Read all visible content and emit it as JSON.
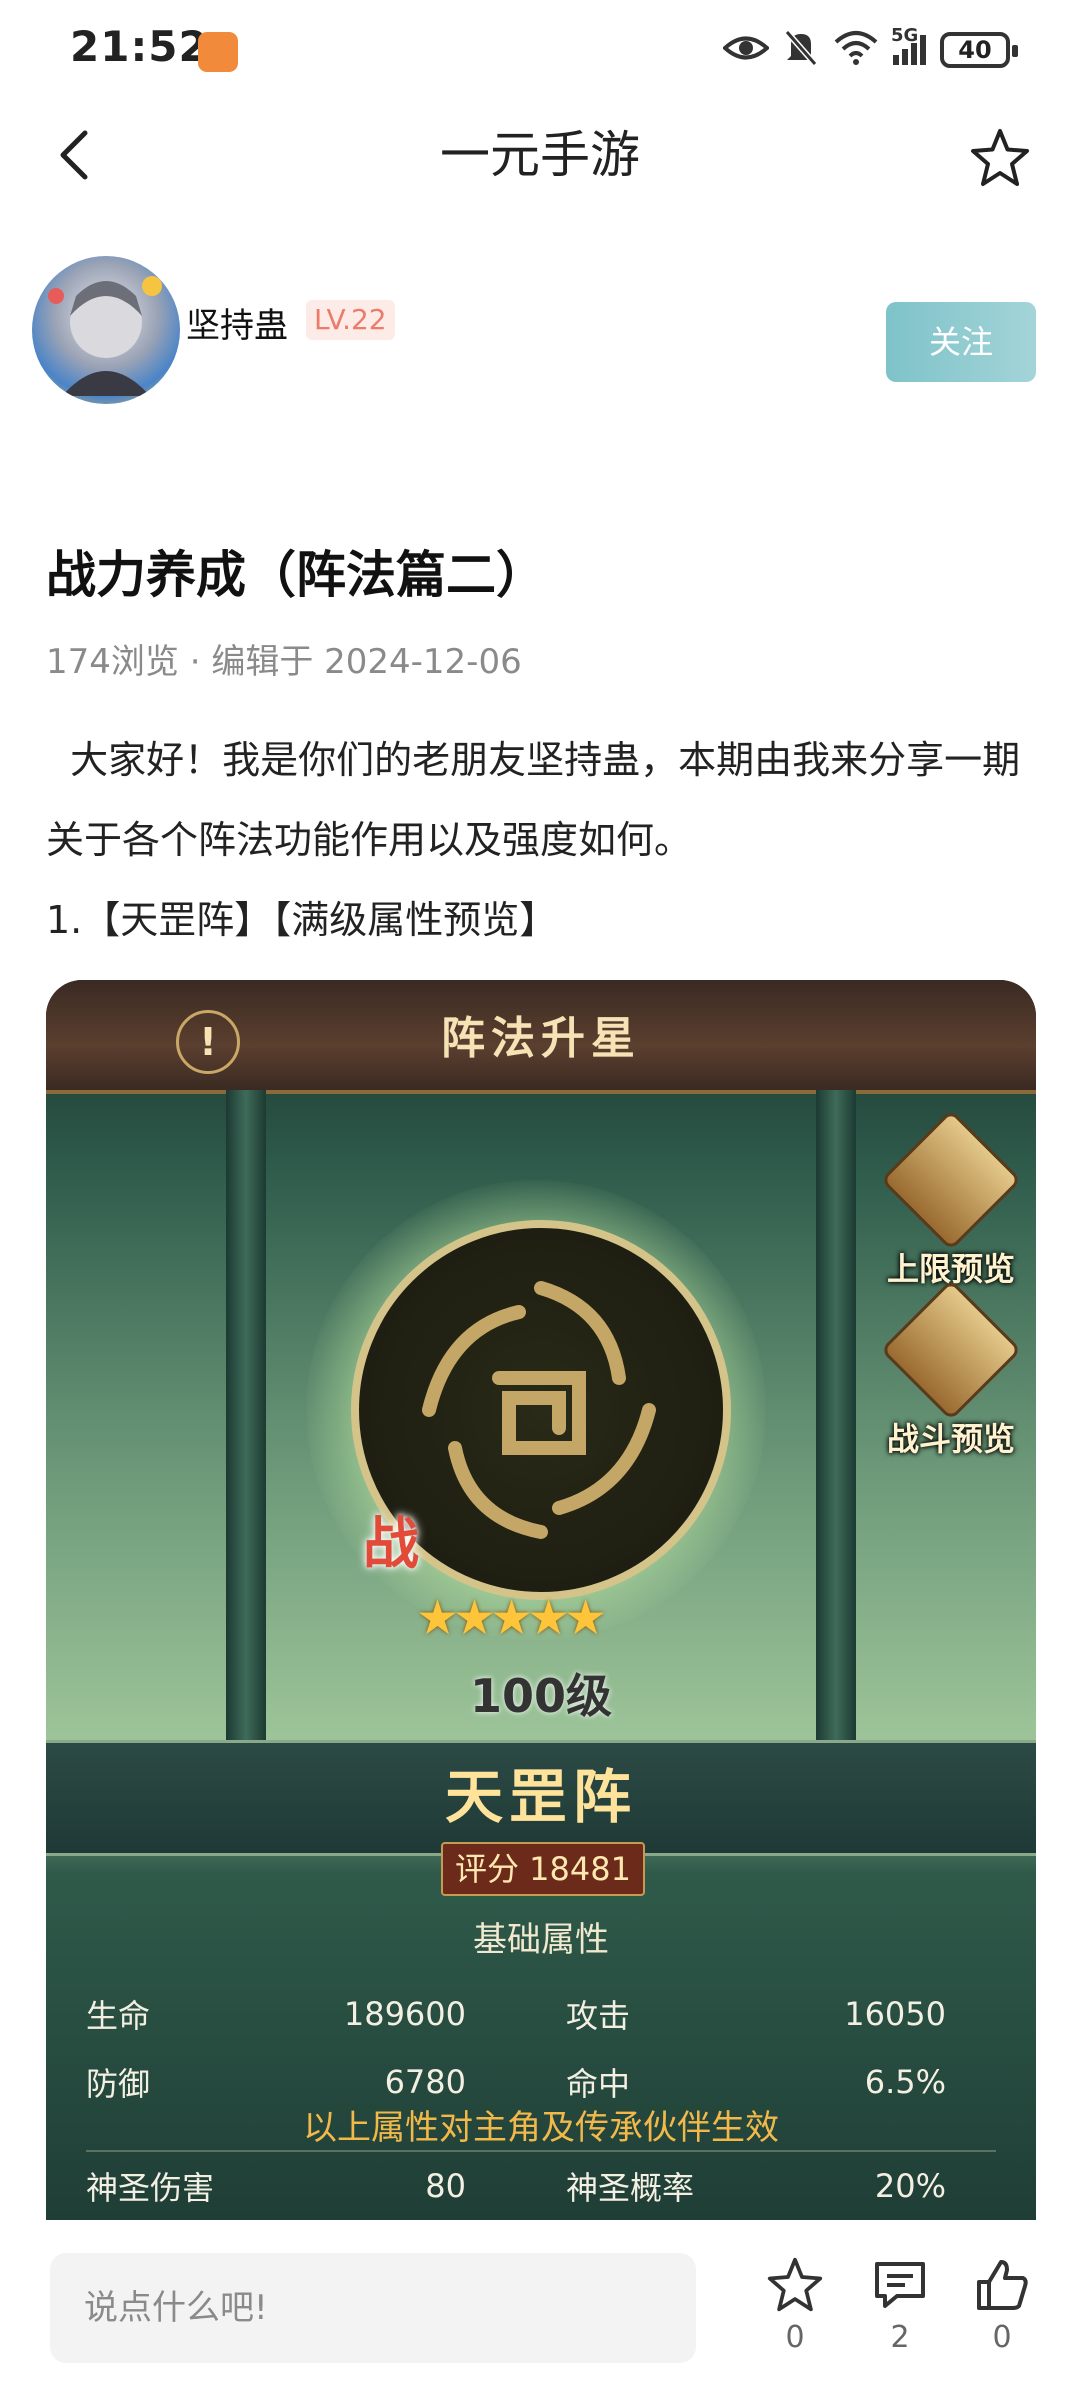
{
  "status_bar": {
    "time": "21:52",
    "battery": "40",
    "network": "5G"
  },
  "nav": {
    "title": "一元手游"
  },
  "author": {
    "name": "坚持蛊",
    "level": "LV.22",
    "follow_label": "关注"
  },
  "post": {
    "title": "战力养成（阵法篇二）",
    "meta": "174浏览 · 编辑于 2024-12-06",
    "paragraphs": [
      "  大家好！我是你们的老朋友坚持蛊，本期由我来分享一期关于各个阵法功能作用以及强度如何。",
      "1.【天罡阵】【满级属性预览】"
    ]
  },
  "game_screenshot": {
    "header_title": "阵法升星",
    "info_icon": "!",
    "side_buttons": [
      {
        "label": "上限预览"
      },
      {
        "label": "战斗预览"
      }
    ],
    "battle_badge": "战",
    "stars": "★★★★★",
    "level": "100级",
    "formation_name": "天罡阵",
    "score": "评分 18481",
    "base_attr_title": "基础属性",
    "attributes": [
      {
        "label": "生命",
        "value": "189600",
        "label2": "攻击",
        "value2": "16050"
      },
      {
        "label": "防御",
        "value": "6780",
        "label2": "命中",
        "value2": "6.5%"
      }
    ],
    "note": "以上属性对主角及传承伙伴生效",
    "extra_attribute": {
      "label": "神圣伤害",
      "value": "80",
      "label2": "神圣概率",
      "value2": "20%"
    }
  },
  "comment_bar": {
    "placeholder": "说点什么吧!",
    "favorite_count": "0",
    "comment_count": "2",
    "like_count": "0"
  }
}
